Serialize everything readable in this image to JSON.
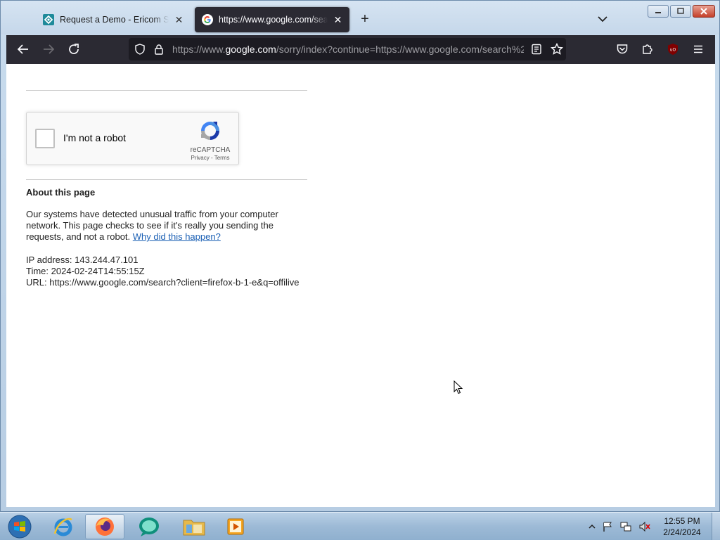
{
  "browser": {
    "tabs": [
      {
        "title": "Request a Demo - Ericom Software",
        "active": false
      },
      {
        "title": "https://www.google.com/search?client",
        "active": true
      }
    ],
    "url": {
      "prefix": "https://www.",
      "host": "google.com",
      "rest": "/sorry/index?continue=https://www.google.com/search%2"
    }
  },
  "page": {
    "captcha": {
      "label": "I'm not a robot",
      "brand": "reCAPTCHA",
      "links": "Privacy - Terms"
    },
    "about": {
      "heading": "About this page",
      "para_before": "Our systems have detected unusual traffic from your computer network. This page checks to see if it's really you sending the requests, and not a robot. ",
      "link": "Why did this happen?"
    },
    "ip_line": "IP address: 143.244.47.101",
    "time_line": "Time: 2024-02-24T14:55:15Z",
    "url_line": "URL: https://www.google.com/search?client=firefox-b-1-e&q=offilive"
  },
  "taskbar": {
    "clock_time": "12:55 PM",
    "clock_date": "2/24/2024"
  },
  "colors": {
    "firefox_dark": "#2b2a33",
    "link_blue": "#1a5fb4",
    "taskbar_blue": "#9dbad6"
  }
}
